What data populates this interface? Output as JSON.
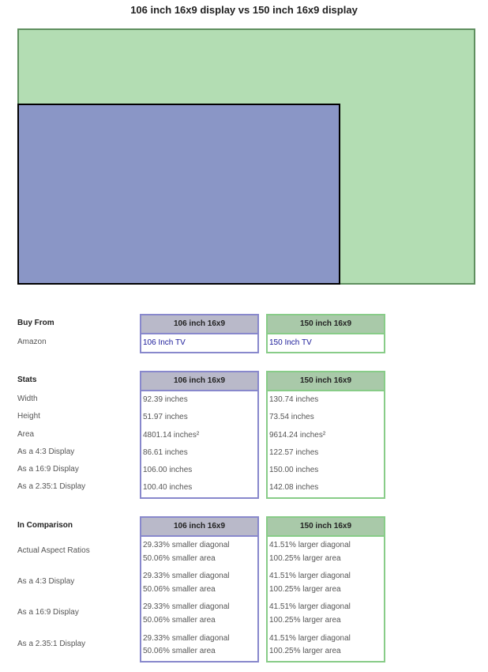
{
  "title": "106 inch 16x9 display vs 150 inch 16x9 display",
  "colors": {
    "display_a_fill": "#8a96c6",
    "display_b_fill": "#b3ddb3",
    "display_a_border": "#8888cc",
    "display_b_border": "#88cc88"
  },
  "columns": [
    "106 inch 16x9",
    "150 inch 16x9"
  ],
  "buy": {
    "heading": "Buy From",
    "label": "Amazon",
    "links": [
      "106 Inch TV",
      "150 Inch TV"
    ]
  },
  "stats": {
    "heading": "Stats",
    "labels": [
      "Width",
      "Height",
      "Area",
      "As a 4:3 Display",
      "As a 16:9 Display",
      "As a 2.35:1 Display"
    ],
    "a": [
      "92.39 inches",
      "51.97 inches",
      "4801.14 inches²",
      "86.61 inches",
      "106.00 inches",
      "100.40 inches"
    ],
    "b": [
      "130.74 inches",
      "73.54 inches",
      "9614.24 inches²",
      "122.57 inches",
      "150.00 inches",
      "142.08 inches"
    ]
  },
  "comparison": {
    "heading": "In Comparison",
    "labels": [
      "Actual Aspect Ratios",
      "As a 4:3 Display",
      "As a 16:9 Display",
      "As a 2.35:1 Display"
    ],
    "a": [
      [
        "29.33% smaller diagonal",
        "50.06% smaller area"
      ],
      [
        "29.33% smaller diagonal",
        "50.06% smaller area"
      ],
      [
        "29.33% smaller diagonal",
        "50.06% smaller area"
      ],
      [
        "29.33% smaller diagonal",
        "50.06% smaller area"
      ]
    ],
    "b": [
      [
        "41.51% larger diagonal",
        "100.25% larger area"
      ],
      [
        "41.51% larger diagonal",
        "100.25% larger area"
      ],
      [
        "41.51% larger diagonal",
        "100.25% larger area"
      ],
      [
        "41.51% larger diagonal",
        "100.25% larger area"
      ]
    ]
  }
}
